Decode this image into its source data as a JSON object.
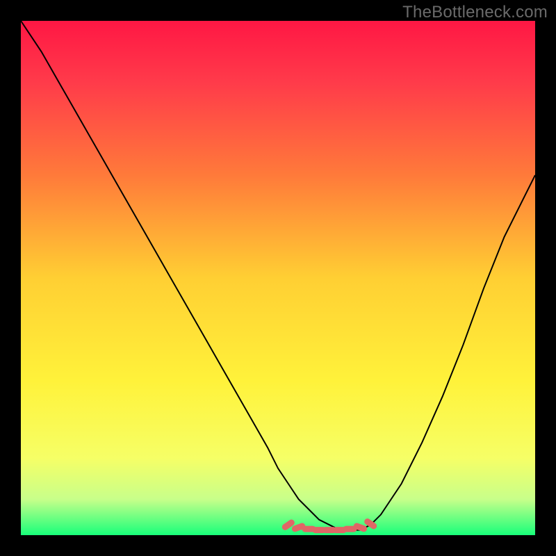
{
  "watermark": "TheBottleneck.com",
  "colors": {
    "gradient_stops": [
      {
        "offset": 0.0,
        "color": "#ff1744"
      },
      {
        "offset": 0.12,
        "color": "#ff3b4a"
      },
      {
        "offset": 0.3,
        "color": "#ff7a3a"
      },
      {
        "offset": 0.5,
        "color": "#ffcf33"
      },
      {
        "offset": 0.7,
        "color": "#fff23a"
      },
      {
        "offset": 0.85,
        "color": "#f6ff66"
      },
      {
        "offset": 0.93,
        "color": "#c8ff8a"
      },
      {
        "offset": 1.0,
        "color": "#18ff7a"
      }
    ],
    "curve_stroke": "#000000",
    "marker_fill": "#e06666",
    "marker_stroke": "#c94f4f"
  },
  "chart_data": {
    "type": "line",
    "title": "",
    "xlabel": "",
    "ylabel": "",
    "xlim": [
      0,
      100
    ],
    "ylim": [
      0,
      100
    ],
    "x": [
      0,
      4,
      8,
      12,
      16,
      20,
      24,
      28,
      32,
      36,
      40,
      44,
      48,
      50,
      52,
      54,
      56,
      58,
      60,
      62,
      64,
      66,
      68,
      70,
      74,
      78,
      82,
      86,
      90,
      94,
      98,
      100
    ],
    "values": [
      100,
      94,
      87,
      80,
      73,
      66,
      59,
      52,
      45,
      38,
      31,
      24,
      17,
      13,
      10,
      7,
      5,
      3,
      2,
      1,
      1,
      1,
      2,
      4,
      10,
      18,
      27,
      37,
      48,
      58,
      66,
      70
    ],
    "markers": {
      "x": [
        52,
        54,
        56,
        58,
        60,
        62,
        64,
        66,
        68
      ],
      "y": [
        2,
        1.5,
        1.2,
        1,
        1,
        1,
        1.2,
        1.5,
        2.2
      ]
    }
  }
}
